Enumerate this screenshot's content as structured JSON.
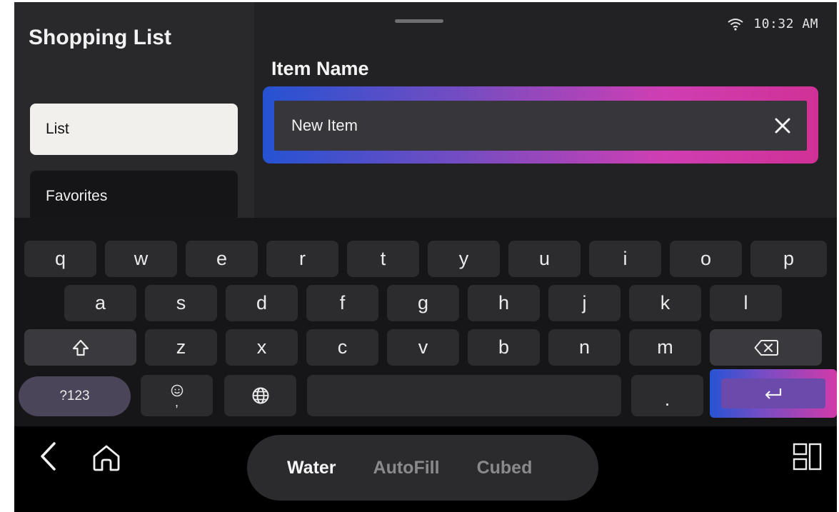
{
  "sidebar": {
    "title": "Shopping List",
    "items": [
      {
        "label": "List",
        "active": true
      },
      {
        "label": "Favorites",
        "active": false
      }
    ]
  },
  "status": {
    "time": "10:32 AM",
    "wifi_icon": "wifi-icon"
  },
  "field": {
    "label": "Item Name",
    "value": "New Item",
    "clear_icon": "close-icon"
  },
  "keyboard": {
    "row1": [
      "q",
      "w",
      "e",
      "r",
      "t",
      "y",
      "u",
      "i",
      "o",
      "p"
    ],
    "row2": [
      "a",
      "s",
      "d",
      "f",
      "g",
      "h",
      "j",
      "k",
      "l"
    ],
    "row3": [
      "z",
      "x",
      "c",
      "v",
      "b",
      "n",
      "m"
    ],
    "symbols_label": "?123",
    "emoji_comma": ",",
    "period": ".",
    "enter_icon": "enter-icon"
  },
  "bottom": {
    "modes": [
      {
        "label": "Water",
        "active": true
      },
      {
        "label": "AutoFill",
        "active": false
      },
      {
        "label": "Cubed",
        "active": false
      }
    ]
  },
  "colors": {
    "accent_blue": "#2552d2",
    "accent_pink": "#d03196",
    "active_item_bg": "#f1f0ec"
  }
}
